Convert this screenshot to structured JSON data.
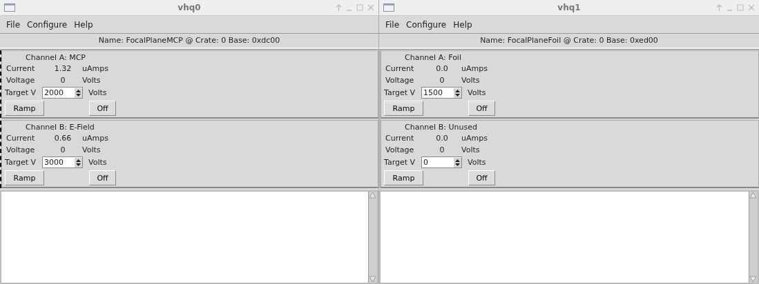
{
  "windows": [
    {
      "title": "vhq0",
      "menu": [
        "File",
        "Configure",
        "Help"
      ],
      "name_line": "Name: FocalPlaneMCP @ Crate: 0 Base: 0xdc00",
      "focused": true,
      "channels": [
        {
          "title": "Channel A: MCP",
          "current_label": "Current",
          "current": "1.32",
          "current_unit": "uAmps",
          "voltage_label": "Voltage",
          "voltage": "0",
          "voltage_unit": "Volts",
          "target_label": "Target V",
          "target": "2000",
          "target_unit": "Volts",
          "ramp": "Ramp",
          "off": "Off"
        },
        {
          "title": "Channel B: E-Field",
          "current_label": "Current",
          "current": "0.66",
          "current_unit": "uAmps",
          "voltage_label": "Voltage",
          "voltage": "0",
          "voltage_unit": "Volts",
          "target_label": "Target V",
          "target": "3000",
          "target_unit": "Volts",
          "ramp": "Ramp",
          "off": "Off"
        }
      ]
    },
    {
      "title": "vhq1",
      "menu": [
        "File",
        "Configure",
        "Help"
      ],
      "name_line": "Name: FocalPlaneFoil @ Crate: 0 Base: 0xed00",
      "focused": false,
      "channels": [
        {
          "title": "Channel A: Foil",
          "current_label": "Current",
          "current": "0.0",
          "current_unit": "uAmps",
          "voltage_label": "Voltage",
          "voltage": "0",
          "voltage_unit": "Volts",
          "target_label": "Target V",
          "target": "1500",
          "target_unit": "Volts",
          "ramp": "Ramp",
          "off": "Off"
        },
        {
          "title": "Channel B: Unused",
          "current_label": "Current",
          "current": "0.0",
          "current_unit": "uAmps",
          "voltage_label": "Voltage",
          "voltage": "0",
          "voltage_unit": "Volts",
          "target_label": "Target V",
          "target": "0",
          "target_unit": "Volts",
          "ramp": "Ramp",
          "off": "Off"
        }
      ]
    }
  ]
}
